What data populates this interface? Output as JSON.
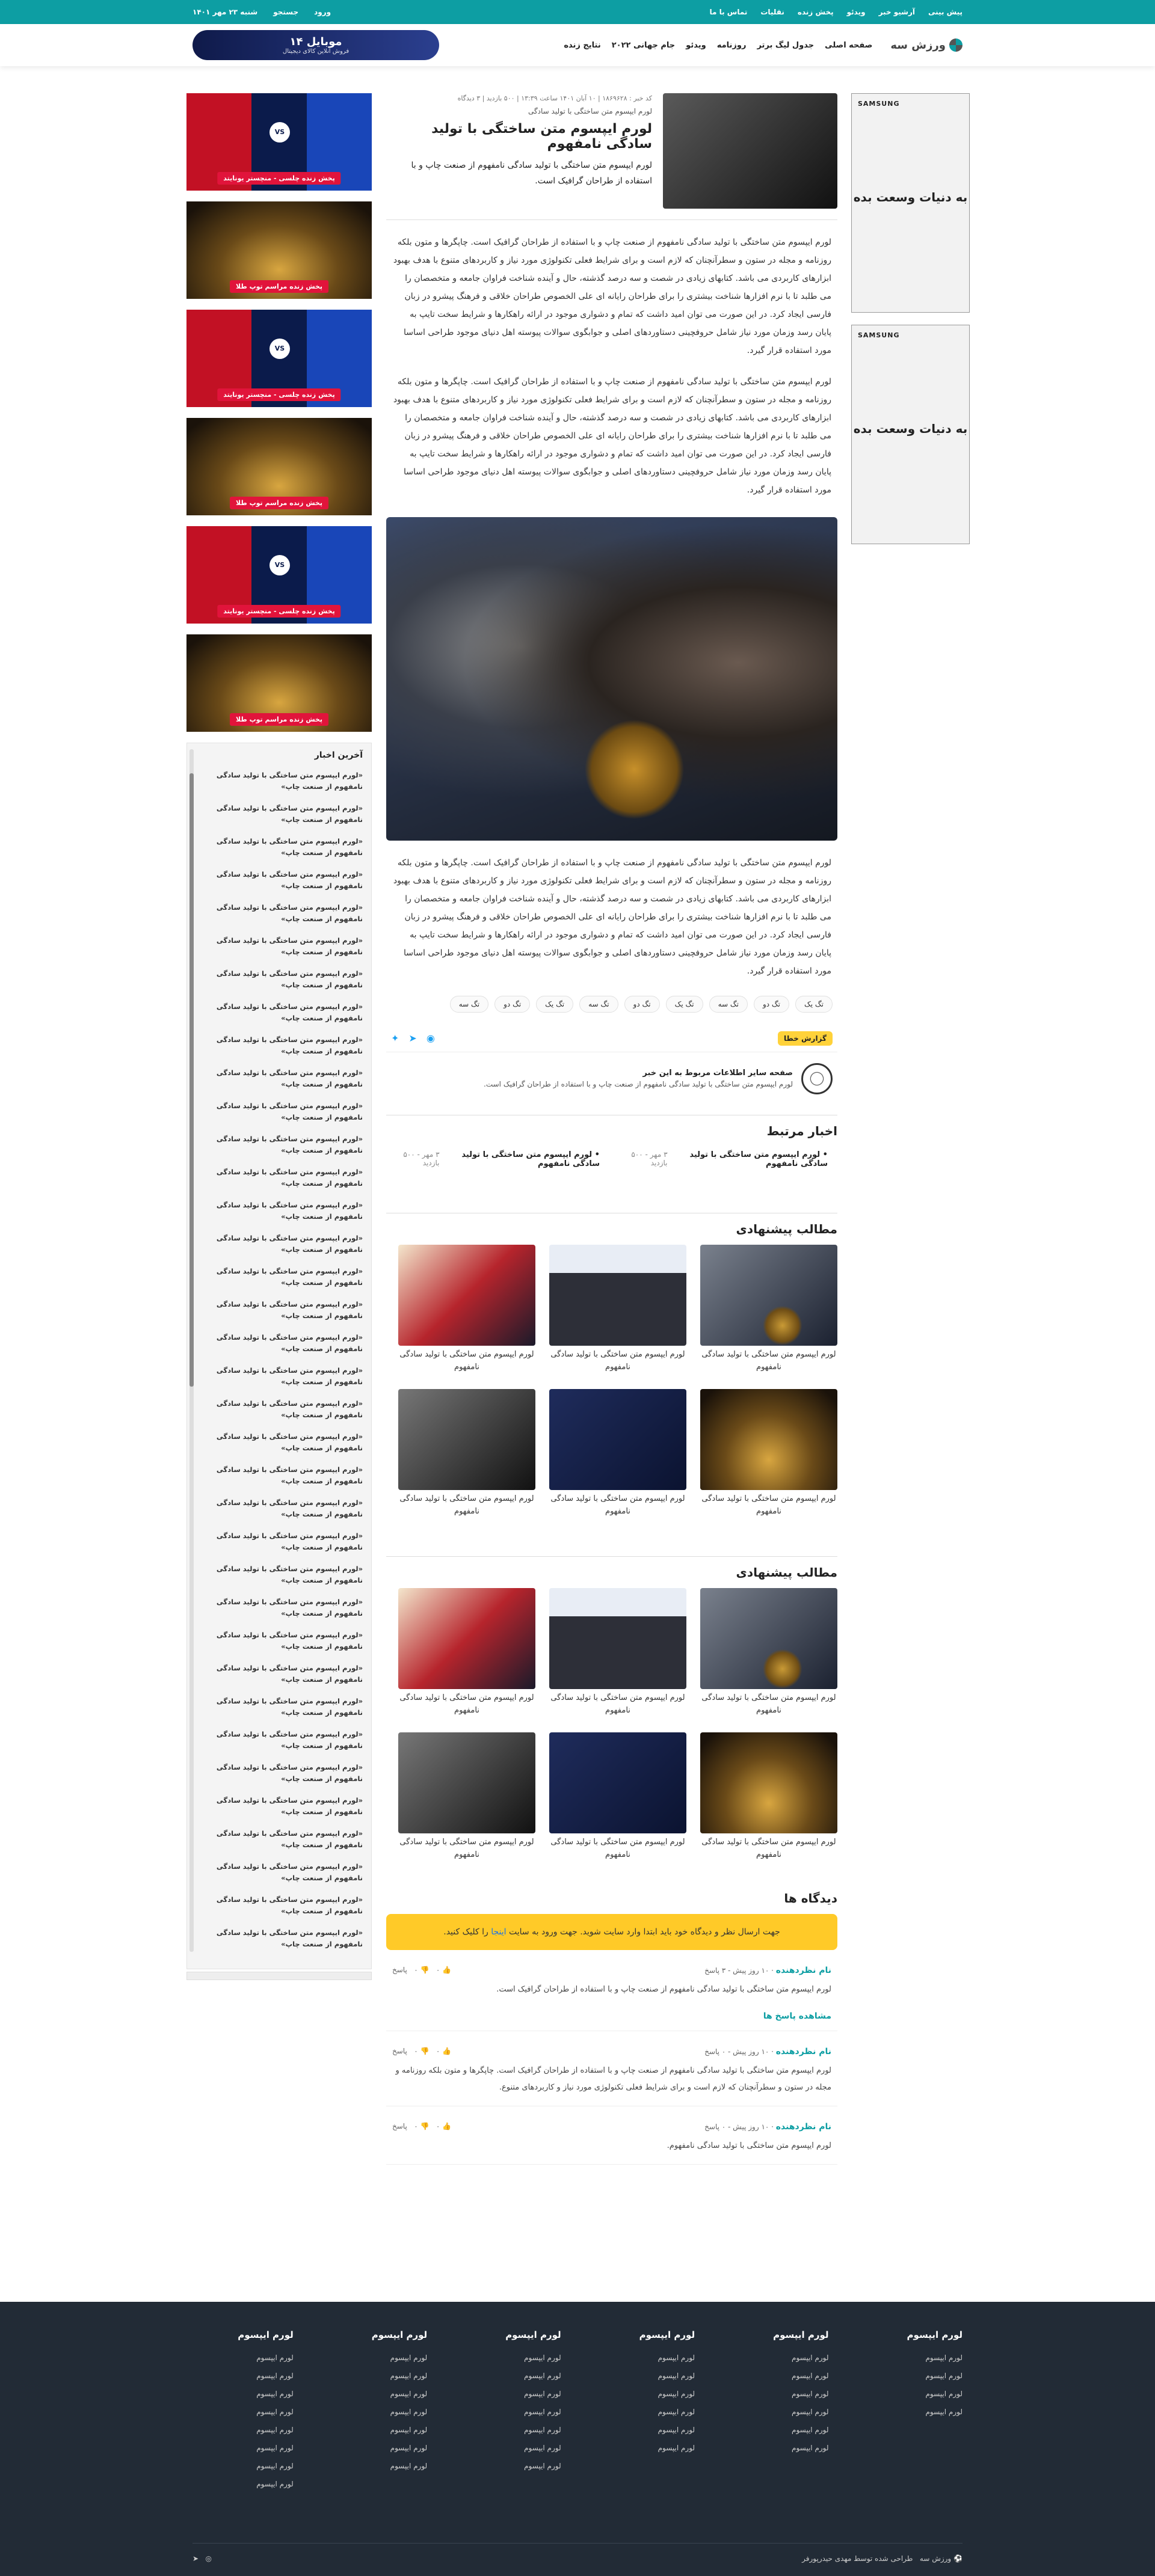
{
  "topbar": {
    "links": [
      "پیش بینی",
      "آرشیو خبر",
      "ویدئو",
      "پخش زنده",
      "نقلیات",
      "تماس با ما"
    ],
    "right": [
      "ورود",
      "جستجو",
      "شنبه ۲۳ مهر ۱۴۰۱"
    ]
  },
  "header": {
    "logo": "ورزش سه",
    "nav": [
      "صفحه اصلی",
      "جدول لیگ برتر",
      "روزنامه",
      "ویدئو",
      "جام جهانی ۲۰۲۲",
      "نتایج زنده"
    ],
    "banner_title": "موبایل ۱۴",
    "banner_sub": "فروش آنلاین کالای دیجیتال"
  },
  "ads": [
    {
      "brand": "SAMSUNG",
      "text": "به دنیات وسعت بده"
    },
    {
      "brand": "SAMSUNG",
      "text": "به دنیات وسعت بده"
    }
  ],
  "thumbs": [
    {
      "kind": "red",
      "label": "پخش زنده چلسی - منچستر یونایتد"
    },
    {
      "kind": "gold",
      "label": "پخش زنده مراسم توپ طلا"
    },
    {
      "kind": "red",
      "label": "پخش زنده چلسی - منچستر یونایتد"
    },
    {
      "kind": "gold",
      "label": "پخش زنده مراسم توپ طلا"
    },
    {
      "kind": "red",
      "label": "پخش زنده چلسی - منچستر یونایتد"
    },
    {
      "kind": "gold",
      "label": "پخش زنده مراسم توپ طلا"
    }
  ],
  "latest": {
    "title": "آخرین اخبار",
    "item": "«لورم ایپسوم متن ساختگی با تولید سادگی نامفهوم از صنعت چاپ»"
  },
  "article": {
    "meta": "کد خبر : ۱۸۶۹۶۲۸ | ۱۰ آبان ۱۴۰۱ ساعت ۱۳:۳۹ | ۵۰۰ بازدید | ۳ دیدگاه",
    "kicker": "لورم ایپسوم متن ساختگی با تولید سادگی",
    "title": "لورم ایپسوم متن ساختگی با تولید سادگی نامفهوم",
    "summary": "لورم ایپسوم متن ساختگی با تولید سادگی نامفهوم از صنعت چاپ و با استفاده از طراحان گرافیک است.",
    "paragraph": "لورم ایپسوم متن ساختگی با تولید سادگی نامفهوم از صنعت چاپ و با استفاده از طراحان گرافیک است. چاپگرها و متون بلکه روزنامه و مجله در ستون و سطرآنچنان که لازم است و برای شرایط فعلی تکنولوژی مورد نیاز و کاربردهای متنوع با هدف بهبود ابزارهای کاربردی می باشد. کتابهای زیادی در شصت و سه درصد گذشته، حال و آینده شناخت فراوان جامعه و متخصصان را می طلبد تا با نرم افزارها شناخت بیشتری را برای طراحان رایانه ای علی الخصوص طراحان خلاقی و فرهنگ پیشرو در زبان فارسی ایجاد کرد. در این صورت می توان امید داشت که تمام و دشواری موجود در ارائه راهکارها و شرایط سخت تایپ به پایان رسد وزمان مورد نیاز شامل حروفچینی دستاوردهای اصلی و جوابگوی سوالات پیوسته اهل دنیای موجود طراحی اساسا مورد استفاده قرار گیرد."
  },
  "tags": [
    "تگ یک",
    "تگ دو",
    "تگ سه",
    "تگ یک",
    "تگ دو",
    "تگ سه",
    "تگ یک",
    "تگ دو",
    "تگ سه"
  ],
  "share": {
    "report": "گزارش خطا"
  },
  "team": {
    "title": "صفحه سایر اطلاعات مربوط به این خبر",
    "text": "لورم ایپسوم متن ساختگی با تولید سادگی نامفهوم از صنعت چاپ و با استفاده از طراحان گرافیک است."
  },
  "related": {
    "title": "اخبار مرتبط",
    "items": [
      {
        "t": "• لورم ایپسوم متن ساختگی با تولید سادگی نامفهوم",
        "m": "۳ مهر - ۵۰۰ بازدید"
      },
      {
        "t": "• لورم ایپسوم متن ساختگی با تولید سادگی نامفهوم",
        "m": "۳ مهر - ۵۰۰ بازدید"
      }
    ]
  },
  "suggest": {
    "title": "مطالب پیشنهادی",
    "card": "لورم ایپسوم متن ساختگی با تولید سادگی نامفهوم"
  },
  "comments": {
    "title": "دیدگاه ها",
    "alert_pre": "جهت ارسال نظر و دیدگاه خود باید ابتدا وارد سایت شوید. جهت ورود به سایت",
    "alert_link": "اینجا",
    "alert_post": "را کلیک کنید.",
    "list": [
      {
        "name": "نام نظردهنده",
        "time": "۱۰ روز پیش - ۳ پاسخ",
        "text": "لورم ایپسوم متن ساختگی با تولید سادگی نامفهوم از صنعت چاپ و با استفاده از طراحان گرافیک است.",
        "more": "مشاهده پاسخ ها"
      },
      {
        "name": "نام نظردهنده",
        "time": "۱۰ روز پیش - ۰ پاسخ",
        "text": "لورم ایپسوم متن ساختگی با تولید سادگی نامفهوم از صنعت چاپ و با استفاده از طراحان گرافیک است. چاپگرها و متون بلکه روزنامه و مجله در ستون و سطرآنچنان که لازم است و برای شرایط فعلی تکنولوژی مورد نیاز و کاربردهای متنوع."
      },
      {
        "name": "نام نظردهنده",
        "time": "۱۰ روز پیش - ۰ پاسخ",
        "text": "لورم ایپسوم متن ساختگی با تولید سادگی نامفهوم."
      }
    ],
    "reply": "پاسخ"
  },
  "footer": {
    "cols": [
      {
        "title": "لورم ایپسوم",
        "n": 4
      },
      {
        "title": "لورم ایپسوم",
        "n": 6
      },
      {
        "title": "لورم ایپسوم",
        "n": 6
      },
      {
        "title": "لورم ایپسوم",
        "n": 7
      },
      {
        "title": "لورم ایپسوم",
        "n": 7
      },
      {
        "title": "لورم ایپسوم",
        "n": 8
      }
    ],
    "item": "لورم ایپسوم",
    "credit": "طراحی شده توسط مهدی حیدرپورفر",
    "logo": "ورزش سه"
  }
}
